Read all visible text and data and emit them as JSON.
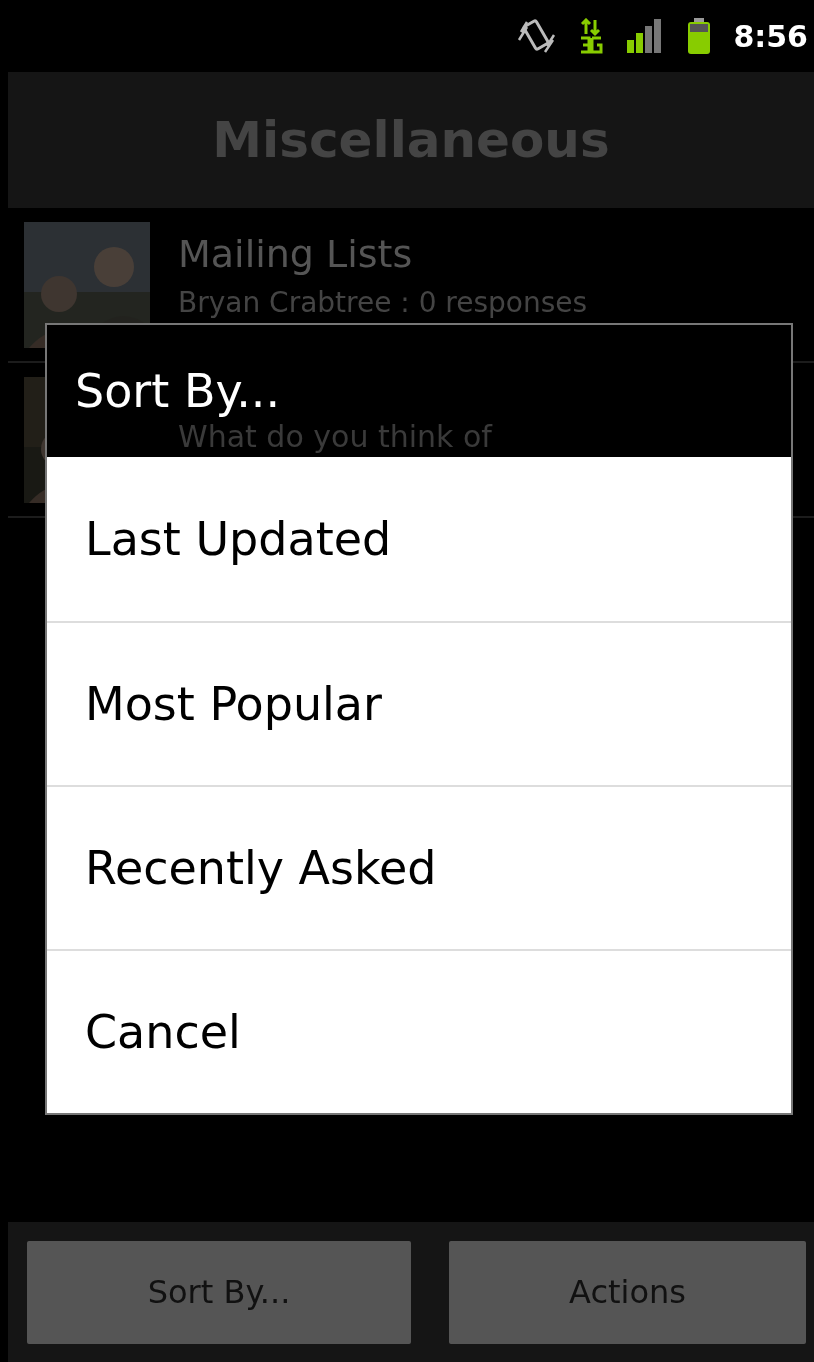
{
  "status_bar": {
    "time": "8:56"
  },
  "title": "Miscellaneous",
  "list": [
    {
      "title": "Mailing Lists",
      "subtitle": "Bryan Crabtree : 0 responses"
    },
    {
      "title": "What do you think of"
    }
  ],
  "dialog": {
    "title": "Sort By...",
    "options": [
      "Last Updated",
      "Most Popular",
      "Recently Asked",
      "Cancel"
    ]
  },
  "buttons": [
    "Sort By...",
    "Actions"
  ]
}
